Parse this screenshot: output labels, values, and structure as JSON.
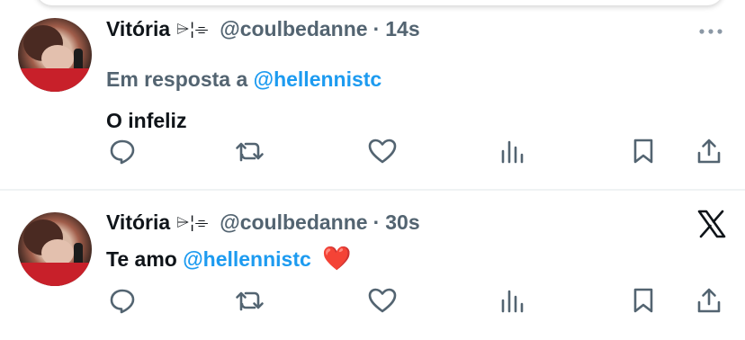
{
  "tweets": [
    {
      "author_name": "Vitória",
      "name_emoji": "⌲¦⌯",
      "handle": "@coulbedanne",
      "separator": "·",
      "time": "14s",
      "reply_prefix": "Em resposta a",
      "reply_mention": "@hellennistc",
      "text": "O infeliz",
      "text_mention": "",
      "text_emoji": "",
      "corner_icon": "more-icon"
    },
    {
      "author_name": "Vitória",
      "name_emoji": "⌲¦⌯",
      "handle": "@coulbedanne",
      "separator": "·",
      "time": "30s",
      "reply_prefix": "",
      "reply_mention": "",
      "text": "Te amo",
      "text_mention": "@hellennistc",
      "text_emoji": "❤️",
      "corner_icon": "x-logo-icon"
    }
  ],
  "action_icons": [
    "reply-icon",
    "retweet-icon",
    "like-icon",
    "views-icon",
    "bookmark-icon",
    "share-icon"
  ],
  "colors": {
    "text": "#0f1419",
    "secondary": "#536471",
    "link": "#1d9bf0",
    "heart": "#e0245e",
    "divider": "#eff3f4"
  }
}
